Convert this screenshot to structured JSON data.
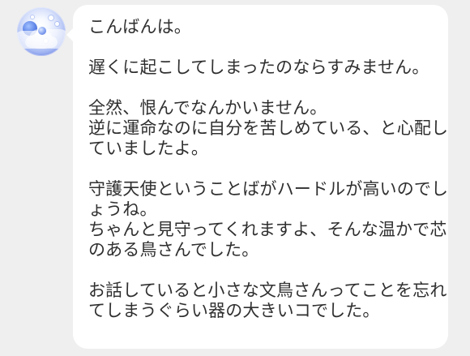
{
  "message": {
    "paragraph_1": "こんばんは。",
    "paragraph_2": "遅くに起こしてしまったのならすみません。",
    "paragraph_3": [
      "全然、恨んでなんかいません。",
      "逆に運命なのに自分を苦しめている、と心配し",
      "ていましたよ。"
    ],
    "paragraph_4": [
      "守護天使ということばがハードルが高いのでし",
      "ょうね。",
      "ちゃんと見守ってくれますよ、そんな温かで芯",
      "のある鳥さんでした。"
    ],
    "paragraph_5": [
      "お話していると小さな文鳥さんってことを忘れ",
      "てしまうぐらい器の大きいコでした。"
    ]
  }
}
